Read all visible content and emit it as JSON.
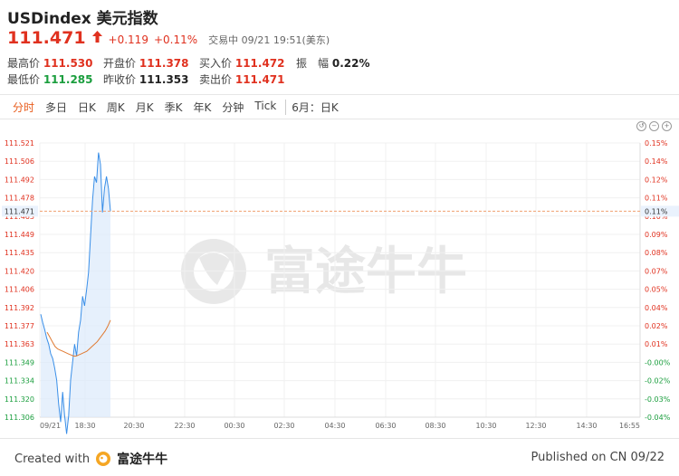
{
  "header": {
    "title": "USDindex 美元指数",
    "price": "111.471",
    "change": "+0.119",
    "change_pct": "+0.11%",
    "status": "交易中 09/21 19:51(美东)"
  },
  "stats": [
    {
      "label": "最高价",
      "value": "111.530",
      "color": "red"
    },
    {
      "label": "开盘价",
      "value": "111.378",
      "color": "red"
    },
    {
      "label": "买入价",
      "value": "111.472",
      "color": "red"
    },
    {
      "label": "振　幅",
      "value": "0.22%",
      "color": "dark"
    },
    {
      "label": "最低价",
      "value": "111.285",
      "color": "green"
    },
    {
      "label": "昨收价",
      "value": "111.353",
      "color": "dark"
    },
    {
      "label": "卖出价",
      "value": "111.471",
      "color": "red"
    }
  ],
  "tabs": [
    "分时",
    "多日",
    "日K",
    "周K",
    "月K",
    "季K",
    "年K",
    "分钟",
    "Tick",
    "6月：日K"
  ],
  "active_tab": "分时",
  "chart_data": {
    "type": "line",
    "y_ticks": [
      "111.521",
      "111.506",
      "111.492",
      "111.478",
      "111.463",
      "111.449",
      "111.435",
      "111.420",
      "111.406",
      "111.392",
      "111.377",
      "111.363",
      "111.349",
      "111.334",
      "111.320",
      "111.306"
    ],
    "pct_ticks": [
      "0.15%",
      "0.14%",
      "0.12%",
      "0.11%",
      "0.10%",
      "0.09%",
      "0.08%",
      "0.07%",
      "0.05%",
      "0.04%",
      "0.02%",
      "0.01%",
      "-0.00%",
      "-0.02%",
      "-0.03%",
      "-0.04%"
    ],
    "x_ticks": [
      "09/21",
      "18:30",
      "20:30",
      "22:30",
      "00:30",
      "02:30",
      "04:30",
      "06:30",
      "08:30",
      "10:30",
      "12:30",
      "14:30",
      "16:55"
    ],
    "current_label": "111.471",
    "current_pct": "0.11%",
    "prev_close": 111.353,
    "ylim": [
      111.299,
      111.528
    ],
    "series": [
      {
        "values": [
          111.385,
          111.378,
          111.372,
          111.365,
          111.36,
          111.352,
          111.348,
          111.34,
          111.33,
          111.31,
          111.295,
          111.32,
          111.3,
          111.285,
          111.3,
          111.33,
          111.345,
          111.36,
          111.35,
          111.37,
          111.38,
          111.4,
          111.392,
          111.405,
          111.42,
          111.45,
          111.48,
          111.5,
          111.495,
          111.52,
          111.51,
          111.47,
          111.49,
          111.5,
          111.49,
          111.471
        ],
        "color": "#3a8fe8"
      },
      {
        "values": [
          111.37,
          111.366,
          111.362,
          111.358,
          111.356,
          111.355,
          111.354,
          111.353,
          111.352,
          111.351,
          111.35,
          111.35,
          111.351,
          111.352,
          111.353,
          111.354,
          111.356,
          111.358,
          111.36,
          111.362,
          111.365,
          111.368,
          111.371,
          111.375,
          111.38
        ],
        "color": "#e07a32"
      }
    ]
  },
  "watermark": "富途牛牛",
  "footer": {
    "created_with": "Created with",
    "brand": "富途牛牛",
    "published": "Published on CN 09/22"
  }
}
